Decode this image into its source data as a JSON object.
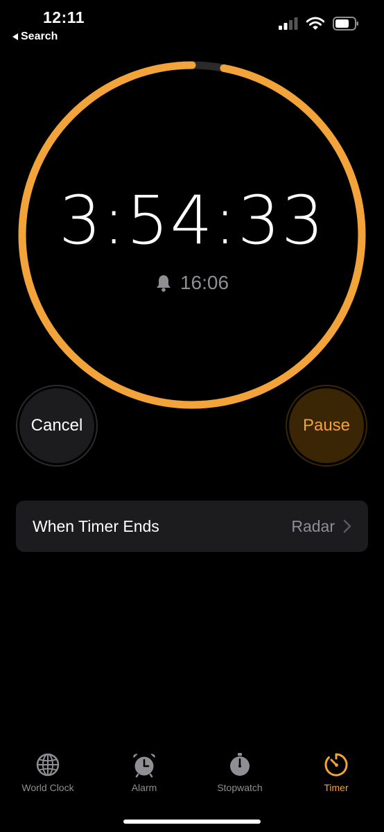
{
  "status_bar": {
    "time": "12:11",
    "back_label": "Search"
  },
  "timer": {
    "remaining": "3:54:33",
    "end_time": "16:06",
    "progress_remaining_fraction": 0.97
  },
  "controls": {
    "cancel_label": "Cancel",
    "pause_label": "Pause"
  },
  "settings": {
    "when_timer_ends_label": "When Timer Ends",
    "sound_value": "Radar"
  },
  "tabs": [
    {
      "label": "World Clock",
      "icon": "globe-icon",
      "active": false
    },
    {
      "label": "Alarm",
      "icon": "alarm-clock-icon",
      "active": false
    },
    {
      "label": "Stopwatch",
      "icon": "stopwatch-icon",
      "active": false
    },
    {
      "label": "Timer",
      "icon": "timer-icon",
      "active": true
    }
  ],
  "colors": {
    "accent": "#f2a33a",
    "ring_track": "#2a2a2a",
    "secondary_text": "#8e8e93",
    "row_background": "#1c1c1e"
  }
}
